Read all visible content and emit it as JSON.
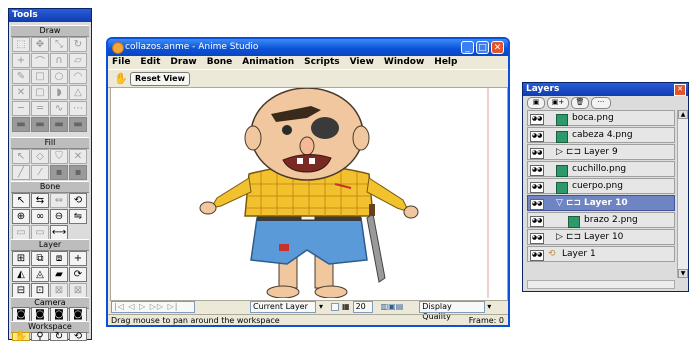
{
  "tools": {
    "title": "Tools",
    "sections": {
      "draw": "Draw",
      "fill": "Fill",
      "bone": "Bone",
      "layer": "Layer",
      "camera": "Camera",
      "workspace": "Workspace"
    }
  },
  "window": {
    "title": "collazos.anme - Anime Studio",
    "menu": [
      "File",
      "Edit",
      "Draw",
      "Bone",
      "Animation",
      "Scripts",
      "View",
      "Window",
      "Help"
    ],
    "reset_view": "Reset View",
    "bottom": {
      "layer_select": "Current Layer",
      "frame_value": "20",
      "quality_select": "Display Quality"
    },
    "status_left": "Drag mouse to pan around the workspace",
    "status_right": "Frame: 0"
  },
  "layers": {
    "title": "Layers",
    "rows": [
      {
        "name": "boca.png",
        "type": "image",
        "selected": false
      },
      {
        "name": "cabeza 4.png",
        "type": "image",
        "selected": false
      },
      {
        "name": "Layer 9",
        "type": "bone",
        "selected": false
      },
      {
        "name": "cuchillo.png",
        "type": "image",
        "selected": false
      },
      {
        "name": "cuerpo.png",
        "type": "image",
        "selected": false
      },
      {
        "name": "Layer 10",
        "type": "bone",
        "selected": true
      },
      {
        "name": "brazo 2.png",
        "type": "image",
        "selected": false
      },
      {
        "name": "Layer 10",
        "type": "bone",
        "selected": false
      },
      {
        "name": "Layer 1",
        "type": "switch",
        "selected": false
      }
    ]
  },
  "colors": {
    "titlebar": "#0a50d8",
    "selection": "#6f84c2",
    "shirt": "#f2c12e",
    "pants": "#5b9ad8"
  }
}
